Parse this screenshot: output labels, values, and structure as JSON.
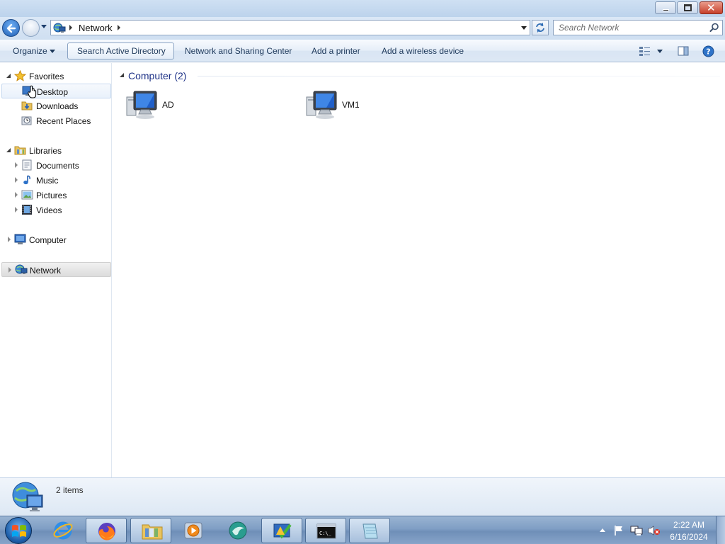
{
  "window": {
    "controls": {
      "minimize": "minimize",
      "maximize": "restore",
      "close": "close"
    }
  },
  "address": {
    "breadcrumb": [
      "Network"
    ],
    "search_placeholder": "Search Network"
  },
  "toolbar": {
    "organize": "Organize",
    "search_ad": "Search Active Directory",
    "network_center": "Network and Sharing Center",
    "add_printer": "Add a printer",
    "add_wireless": "Add a wireless device"
  },
  "nav": {
    "favorites": {
      "label": "Favorites",
      "items": [
        "Desktop",
        "Downloads",
        "Recent Places"
      ]
    },
    "libraries": {
      "label": "Libraries",
      "items": [
        "Documents",
        "Music",
        "Pictures",
        "Videos"
      ]
    },
    "computer": "Computer",
    "network": "Network"
  },
  "content": {
    "group_header": "Computer (2)",
    "computers": [
      "AD",
      "VM1"
    ]
  },
  "details": {
    "count": "2 items"
  },
  "taskbar": {
    "apps": [
      "internet-explorer",
      "firefox",
      "windows-explorer",
      "media-player",
      "app",
      "app",
      "command-prompt",
      "notepad"
    ],
    "clock": {
      "time": "2:22 AM",
      "date": "6/16/2024"
    }
  },
  "colors": {
    "accent": "#1e3287",
    "command_text": "#1e395b",
    "titlebar": "#bcd3ec",
    "taskbar": "#7f9ec4",
    "close_button": "#c7412b"
  }
}
